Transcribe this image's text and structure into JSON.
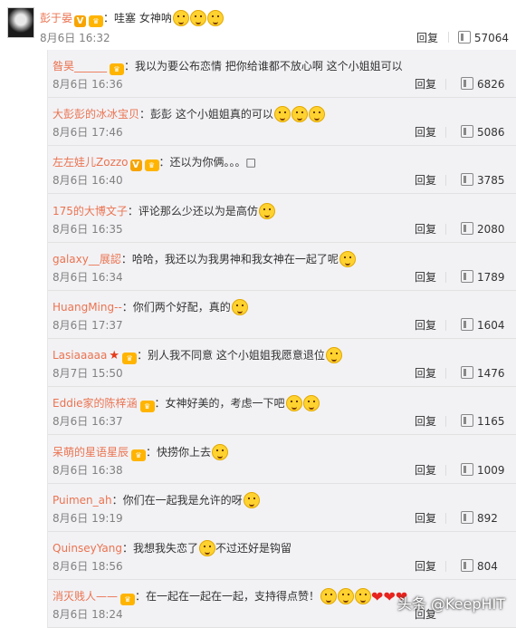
{
  "main": {
    "user": "彭于晏",
    "text": "：哇塞 女神呐",
    "emojis": 3,
    "date": "8月6日 16:32",
    "reply_label": "回复",
    "likes": "57064"
  },
  "replies": [
    {
      "user": "昝昊______",
      "vip": true,
      "text": "：我以为要公布恋情 把你给谁都不放心啊 这个小姐姐可以",
      "emojis": 0,
      "date": "8月6日 16:36",
      "likes": "6826"
    },
    {
      "user": "大彭彭的冰冰宝贝",
      "vip": false,
      "text": "：彭彭 这个小姐姐真的可以",
      "emojis": 3,
      "date": "8月6日 17:46",
      "likes": "5086"
    },
    {
      "user": "左左娃儿Zozzo",
      "vip": true,
      "vbadge": true,
      "text": "：还以为你俩。。。□",
      "emojis": 0,
      "date": "8月6日 16:40",
      "likes": "3785"
    },
    {
      "user": "175的大博文子",
      "vip": false,
      "text": "：评论那么少还以为是高仿",
      "emojis": 1,
      "date": "8月6日 16:35",
      "likes": "2080"
    },
    {
      "user": "galaxy__展認",
      "vip": false,
      "text": "：哈哈，我还以为我男神和我女神在一起了呢",
      "emojis": 1,
      "date": "8月6日 16:34",
      "likes": "1789"
    },
    {
      "user": "HuangMing--",
      "vip": false,
      "text": "：你们两个好配，真的",
      "emojis": 1,
      "date": "8月6日 17:37",
      "likes": "1604"
    },
    {
      "user": "Lasiaaaaa",
      "vip": true,
      "star": true,
      "text": "：别人我不同意 这个小姐姐我愿意退位",
      "emojis": 1,
      "date": "8月7日 15:50",
      "likes": "1476"
    },
    {
      "user": "Eddie家的陈梓涵",
      "vip": true,
      "text": "：女神好美的，考虑一下吧",
      "emojis": 2,
      "date": "8月6日 16:37",
      "likes": "1165"
    },
    {
      "user": "呆萌的星语星辰",
      "vip": true,
      "text": "：快捞你上去",
      "emojis": 1,
      "date": "8月6日 16:38",
      "likes": "1009"
    },
    {
      "user": "Puimen_ah",
      "vip": false,
      "text": "：你们在一起我是允许的呀",
      "emojis": 1,
      "date": "8月6日 19:19",
      "likes": "892"
    },
    {
      "user": "QuinseyYang",
      "vip": false,
      "text": "：我想我失恋了",
      "emojis": 1,
      "text2": "不过还好是钩留",
      "date": "8月6日 18:56",
      "likes": "804"
    },
    {
      "user": "消灭贱人——",
      "vip": true,
      "text": "：在一起在一起在一起，支持得点赞！",
      "emojis": 3,
      "hearts": 3,
      "date": "8月6日 18:24",
      "likes": ""
    }
  ],
  "reply_label": "回复",
  "watermark": "头条 @KeepHIT",
  "colors": {
    "username": "#eb7350",
    "reply_bg": "#f2f2f5",
    "heart": "#e8231e",
    "emoji": "#ffd230"
  }
}
